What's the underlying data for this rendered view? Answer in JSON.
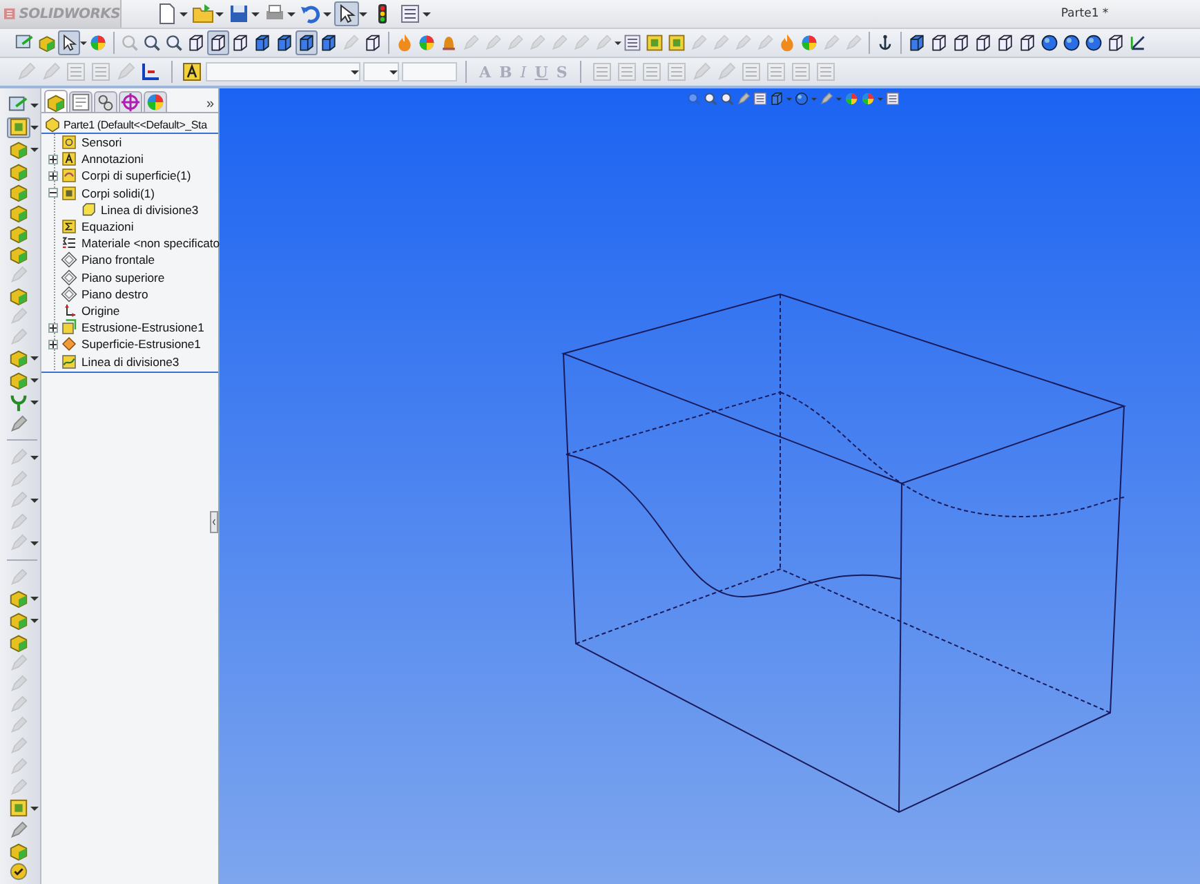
{
  "window": {
    "logo": "SOLIDWORKS",
    "title": "Parte1 *"
  },
  "toolbar_top": [
    {
      "kind": "doc",
      "dropdown": true,
      "pressed": false,
      "disabled": false
    },
    {
      "kind": "folder",
      "dropdown": true,
      "pressed": false,
      "disabled": false
    },
    {
      "kind": "floppy",
      "dropdown": true,
      "pressed": false,
      "disabled": false
    },
    {
      "kind": "printer",
      "dropdown": true,
      "pressed": false,
      "disabled": false
    },
    {
      "kind": "undo",
      "dropdown": true,
      "pressed": false,
      "disabled": false
    },
    {
      "kind": "pointer",
      "dropdown": true,
      "pressed": true,
      "disabled": false
    },
    {
      "kind": "light",
      "pressed": false,
      "disabled": false
    },
    {
      "kind": "list",
      "dropdown": true,
      "pressed": false,
      "disabled": false
    }
  ],
  "toolbar_view": [
    [
      {
        "kind": "sketch",
        "pressed": false,
        "disabled": false
      },
      {
        "kind": "feature",
        "pressed": false,
        "disabled": false
      },
      {
        "kind": "pointer",
        "pressed": true,
        "disabled": false,
        "dropdown": true
      },
      {
        "kind": "ball",
        "pressed": false,
        "disabled": false
      }
    ],
    [
      {
        "kind": "zoom",
        "pressed": false,
        "disabled": true
      },
      {
        "kind": "zoom",
        "pressed": false,
        "disabled": false
      },
      {
        "kind": "zoom",
        "pressed": false,
        "disabled": false
      },
      {
        "kind": "cube",
        "pressed": false,
        "disabled": false
      },
      {
        "kind": "cube",
        "pressed": true,
        "disabled": false
      },
      {
        "kind": "cube",
        "pressed": false,
        "disabled": false
      },
      {
        "kind": "solid",
        "pressed": false,
        "disabled": false
      },
      {
        "kind": "solid",
        "pressed": false,
        "disabled": false
      },
      {
        "kind": "solid",
        "pressed": true,
        "disabled": false
      },
      {
        "kind": "solid",
        "pressed": false,
        "disabled": false
      },
      {
        "kind": "tool",
        "pressed": false,
        "disabled": true
      },
      {
        "kind": "cube",
        "pressed": false,
        "disabled": false
      }
    ],
    [
      {
        "kind": "flame",
        "pressed": false,
        "disabled": false
      },
      {
        "kind": "ball",
        "pressed": false,
        "disabled": false
      },
      {
        "kind": "bell",
        "pressed": false,
        "disabled": false
      },
      {
        "kind": "tool",
        "pressed": false,
        "disabled": true
      },
      {
        "kind": "tool",
        "pressed": false,
        "disabled": true
      },
      {
        "kind": "tool",
        "pressed": false,
        "disabled": true
      },
      {
        "kind": "tool",
        "pressed": false,
        "disabled": true
      },
      {
        "kind": "tool",
        "pressed": false,
        "disabled": true
      },
      {
        "kind": "tool",
        "pressed": false,
        "disabled": true
      },
      {
        "kind": "tool",
        "pressed": false,
        "disabled": true,
        "dropdown": true
      },
      {
        "kind": "list",
        "pressed": false,
        "disabled": false
      },
      {
        "kind": "square",
        "pressed": false,
        "disabled": false
      },
      {
        "kind": "square",
        "pressed": false,
        "disabled": false
      },
      {
        "kind": "tool",
        "pressed": false,
        "disabled": true
      },
      {
        "kind": "tool",
        "pressed": false,
        "disabled": true
      },
      {
        "kind": "tool",
        "pressed": false,
        "disabled": true
      },
      {
        "kind": "tool",
        "pressed": false,
        "disabled": true
      },
      {
        "kind": "flame",
        "pressed": false,
        "disabled": false
      },
      {
        "kind": "ball",
        "pressed": false,
        "disabled": false
      },
      {
        "kind": "tool",
        "pressed": false,
        "disabled": true
      },
      {
        "kind": "tool",
        "pressed": false,
        "disabled": true
      }
    ],
    [
      {
        "kind": "anchor",
        "pressed": false,
        "disabled": false
      }
    ],
    [
      {
        "kind": "solid",
        "pressed": false,
        "disabled": false
      },
      {
        "kind": "cube",
        "pressed": false,
        "disabled": false
      },
      {
        "kind": "cube",
        "pressed": false,
        "disabled": false
      },
      {
        "kind": "cube",
        "pressed": false,
        "disabled": false
      },
      {
        "kind": "cube",
        "pressed": false,
        "disabled": false
      },
      {
        "kind": "cube",
        "pressed": false,
        "disabled": false
      },
      {
        "kind": "sphere",
        "pressed": false,
        "disabled": false
      },
      {
        "kind": "sphere",
        "pressed": false,
        "disabled": false
      },
      {
        "kind": "sphere",
        "pressed": false,
        "disabled": false
      },
      {
        "kind": "cube",
        "pressed": false,
        "disabled": false
      },
      {
        "kind": "axes",
        "pressed": false,
        "disabled": false
      }
    ]
  ],
  "toolbar_format": {
    "icons_left": [
      {
        "kind": "tool",
        "pressed": false,
        "disabled": true
      },
      {
        "kind": "tool",
        "pressed": false,
        "disabled": true
      },
      {
        "kind": "list",
        "pressed": false,
        "disabled": true
      },
      {
        "kind": "list",
        "pressed": false,
        "disabled": true
      },
      {
        "kind": "tool",
        "pressed": false,
        "disabled": true
      },
      {
        "kind": "axes2",
        "pressed": false,
        "disabled": false
      }
    ],
    "style_buttons": [
      "A",
      "B",
      "I",
      "U",
      "S"
    ],
    "icons_right": [
      {
        "kind": "list",
        "pressed": false,
        "disabled": true
      },
      {
        "kind": "list",
        "pressed": false,
        "disabled": true
      },
      {
        "kind": "list",
        "pressed": false,
        "disabled": true
      },
      {
        "kind": "list",
        "pressed": false,
        "disabled": true
      },
      {
        "kind": "tool",
        "pressed": false,
        "disabled": true
      },
      {
        "kind": "tool",
        "pressed": false,
        "disabled": true
      },
      {
        "kind": "list",
        "pressed": false,
        "disabled": true
      },
      {
        "kind": "list",
        "pressed": false,
        "disabled": true
      },
      {
        "kind": "list",
        "pressed": false,
        "disabled": true
      },
      {
        "kind": "list",
        "pressed": false,
        "disabled": true
      }
    ]
  },
  "command_column": [
    {
      "kind": "sketch",
      "pressed": false,
      "disabled": false,
      "dropdown": true
    },
    {
      "kind": "square",
      "pressed": true,
      "disabled": false,
      "dropdown": true
    },
    {
      "kind": "feature",
      "pressed": false,
      "disabled": false,
      "dropdown": true
    },
    {
      "kind": "feature",
      "pressed": false,
      "disabled": false
    },
    {
      "kind": "feature",
      "pressed": false,
      "disabled": false
    },
    {
      "kind": "feature",
      "pressed": false,
      "disabled": false
    },
    {
      "kind": "feature",
      "pressed": false,
      "disabled": false
    },
    {
      "kind": "feature",
      "pressed": false,
      "disabled": false
    },
    {
      "kind": "tool",
      "pressed": false,
      "disabled": true
    },
    {
      "kind": "feature",
      "pressed": false,
      "disabled": false
    },
    {
      "kind": "tool",
      "pressed": false,
      "disabled": true
    },
    {
      "kind": "tool",
      "pressed": false,
      "disabled": true
    },
    {
      "kind": "feature",
      "pressed": false,
      "disabled": false,
      "dropdown": true
    },
    {
      "kind": "feature",
      "pressed": false,
      "disabled": false,
      "dropdown": true
    },
    {
      "kind": "curve",
      "pressed": false,
      "disabled": false,
      "dropdown": true
    },
    {
      "kind": "tool",
      "pressed": false,
      "disabled": false
    },
    {
      "kind": "separator"
    },
    {
      "kind": "tool",
      "pressed": false,
      "disabled": true,
      "dropdown": true
    },
    {
      "kind": "tool",
      "pressed": false,
      "disabled": true
    },
    {
      "kind": "tool",
      "pressed": false,
      "disabled": true,
      "dropdown": true
    },
    {
      "kind": "tool",
      "pressed": false,
      "disabled": true
    },
    {
      "kind": "tool",
      "pressed": false,
      "disabled": true,
      "dropdown": true
    },
    {
      "kind": "separator"
    },
    {
      "kind": "tool",
      "pressed": false,
      "disabled": true
    },
    {
      "kind": "feature",
      "pressed": false,
      "disabled": false,
      "dropdown": true
    },
    {
      "kind": "feature",
      "pressed": false,
      "disabled": false,
      "dropdown": true
    },
    {
      "kind": "feature",
      "pressed": false,
      "disabled": false
    },
    {
      "kind": "tool",
      "pressed": false,
      "disabled": true
    },
    {
      "kind": "tool",
      "pressed": false,
      "disabled": true
    },
    {
      "kind": "tool",
      "pressed": false,
      "disabled": true
    },
    {
      "kind": "tool",
      "pressed": false,
      "disabled": true
    },
    {
      "kind": "tool",
      "pressed": false,
      "disabled": true
    },
    {
      "kind": "tool",
      "pressed": false,
      "disabled": true
    },
    {
      "kind": "tool",
      "pressed": false,
      "disabled": true
    },
    {
      "kind": "square",
      "pressed": false,
      "disabled": false,
      "dropdown": true
    },
    {
      "kind": "tool",
      "pressed": false,
      "disabled": false
    },
    {
      "kind": "feature",
      "pressed": false,
      "disabled": false
    },
    {
      "kind": "check",
      "pressed": false,
      "disabled": false
    }
  ],
  "feature_tree": {
    "tabs": [
      {
        "kind": "feature",
        "selected": true
      },
      {
        "kind": "property",
        "selected": false
      },
      {
        "kind": "config",
        "selected": false
      },
      {
        "kind": "target",
        "selected": false
      },
      {
        "kind": "ball",
        "selected": false
      }
    ],
    "more": "»",
    "root": {
      "label": "Parte1  (Default<<Default>_Sta",
      "kind": "part"
    },
    "items": [
      {
        "label": "Sensori",
        "kind": "sensor"
      },
      {
        "label": "Annotazioni",
        "kind": "annotation",
        "expanded": false
      },
      {
        "label": "Corpi di superficie(1)",
        "kind": "surface_folder",
        "expanded": false
      },
      {
        "label": "Corpi solidi(1)",
        "kind": "solid_folder",
        "expanded": true,
        "children": [
          {
            "label": "Linea di divisione3",
            "kind": "body"
          }
        ]
      },
      {
        "label": "Equazioni",
        "kind": "equation"
      },
      {
        "label": "Materiale <non specificato",
        "kind": "material"
      },
      {
        "label": "Piano frontale",
        "kind": "plane"
      },
      {
        "label": "Piano superiore",
        "kind": "plane"
      },
      {
        "label": "Piano destro",
        "kind": "plane"
      },
      {
        "label": "Origine",
        "kind": "origin"
      },
      {
        "label": "Estrusione-Estrusione1",
        "kind": "extrude",
        "expanded": false
      },
      {
        "label": "Superficie-Estrusione1",
        "kind": "surface",
        "expanded": false
      },
      {
        "label": "Linea di divisione3",
        "kind": "split"
      }
    ]
  },
  "view_toolbar": [
    {
      "kind": "zoom",
      "disabled": true
    },
    {
      "kind": "zoom",
      "disabled": false
    },
    {
      "kind": "zoom",
      "disabled": false
    },
    {
      "kind": "tool",
      "disabled": false
    },
    {
      "kind": "list",
      "disabled": false
    },
    {
      "kind": "solid",
      "disabled": false,
      "dropdown": true
    },
    {
      "kind": "sphere",
      "disabled": false,
      "dropdown": true
    },
    {
      "kind": "tool",
      "disabled": false,
      "dropdown": true
    },
    {
      "kind": "ball",
      "disabled": false
    },
    {
      "kind": "ball",
      "disabled": false,
      "dropdown": true
    },
    {
      "kind": "list",
      "disabled": false
    }
  ]
}
